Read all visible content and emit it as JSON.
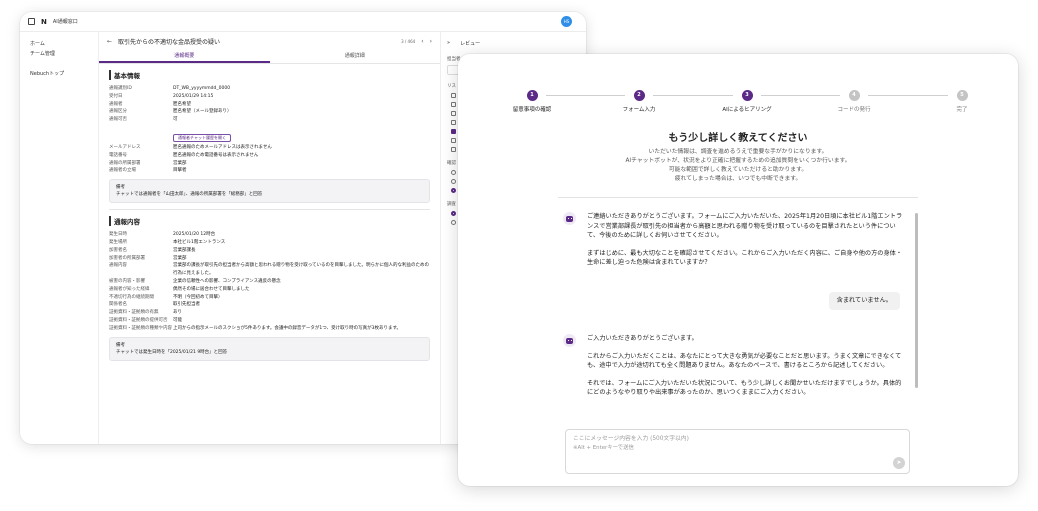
{
  "back_window": {
    "app_title": "AI通報窓口",
    "avatar_initials": "HS",
    "sidebar": [
      "ホーム",
      "チーム管理",
      "Nebuchトップ"
    ],
    "header": {
      "title": "取引先からの不適切な金品授受の疑い",
      "pager": "3 / 464"
    },
    "tabs": [
      "通報概要",
      "通報詳細"
    ],
    "basic_info": {
      "title": "基本情報",
      "rows": [
        {
          "k": "通報識別ID",
          "v": "DT_WB_yyyymmdd_0000"
        },
        {
          "k": "受付日",
          "v": "2025/01/29 14:15"
        },
        {
          "k": "通報者",
          "v": "匿名希望"
        },
        {
          "k": "通報区分",
          "v": "匿名希望（メール登録あり）"
        },
        {
          "k": "通報可否",
          "v": "可"
        }
      ],
      "chip": "通報者チャット履歴を開く",
      "rows2": [
        {
          "k": "メールアドレス",
          "v": "匿名通報のためメールアドレスは表示されません"
        },
        {
          "k": "電話番号",
          "v": "匿名通報のため電話番号は表示されません"
        },
        {
          "k": "通報の所属部署",
          "v": "営業部"
        },
        {
          "k": "通報者の立場",
          "v": "目撃者"
        }
      ],
      "note_label": "備考",
      "note_text": "チャットでは通報者を「山田太郎」、通報の所属部署を「総務部」と回答"
    },
    "report_content": {
      "title": "通報内容",
      "rows": [
        {
          "k": "発生日時",
          "v": "2025/01/20 12時台"
        },
        {
          "k": "発生場所",
          "v": "本社ビル1階エントランス"
        },
        {
          "k": "加害者名",
          "v": "営業部課長"
        },
        {
          "k": "加害者の所属部署",
          "v": "営業部"
        },
        {
          "k": "通報内容",
          "v": "営業部の課長が取引先の担当者から高額と思われる贈り物を受け取っているのを目撃しました。明らかに個人的な利益のための行為に見えました。"
        },
        {
          "k": "被害の内容・影響",
          "v": "企業の信頼性への影響、コンプライアンス違反の懸念"
        },
        {
          "k": "通報者が知った経緯",
          "v": "偶然その場に居合わせて目撃しました"
        },
        {
          "k": "不適切行為の継続期間",
          "v": "不明（今回初めて目撃）"
        },
        {
          "k": "関係者名",
          "v": "取引先担当者"
        },
        {
          "k": "証拠資料・証拠類の有無",
          "v": "あり"
        },
        {
          "k": "証拠資料・証拠類の提供可否",
          "v": "可能"
        },
        {
          "k": "証拠資料・証拠類の種類や内容",
          "v": "上司からの指示メールのスクショが5件あります。会議中の録音データが1つ、受け取り時の写真が3枚あります。"
        }
      ],
      "note_label": "備考",
      "note_text": "チャットでは発生日時を「2025/01/21 9時台」と回答"
    },
    "review": {
      "title": "レビュー",
      "label1": "担当者",
      "label2": "リス",
      "label3": "確認",
      "label4": "調査"
    }
  },
  "front_window": {
    "steps": [
      {
        "num": "1",
        "label": "留意事項の確認",
        "state": "done"
      },
      {
        "num": "2",
        "label": "フォーム入力",
        "state": "done"
      },
      {
        "num": "3",
        "label": "AIによるヒアリング",
        "state": "done"
      },
      {
        "num": "4",
        "label": "コードの発行",
        "state": "todo"
      },
      {
        "num": "5",
        "label": "完了",
        "state": "todo"
      }
    ],
    "heading": "もう少し詳しく教えてください",
    "intro": [
      "いただいた情報は、調査を進めるうえで重要な手がかりになります。",
      "AIチャットボットが、状況をより正確に把握するための追加質問をいくつか行います。",
      "可能な範囲で詳しく教えていただけると助かります。",
      "疲れてしまった場合は、いつでも中断できます。"
    ],
    "messages": {
      "bot1_p1": "ご連絡いただきありがとうございます。フォームにご入力いただいた、2025年1月20日頃に本社ビル1階エントランスで営業部課長が取引先の担当者から高額と思われる贈り物を受け取っているのを目撃されたという件について、今後のために詳しくお伺いさせてください。",
      "bot1_p2": "まずはじめに、最も大切なことを確認させてください。これからご入力いただく内容に、ご自身や他の方の身体・生命に差し迫った危険は含まれていますか？",
      "user1": "含まれていません。",
      "bot2_p1": "ご入力いただきありがとうございます。",
      "bot2_p2": "これからご入力いただくことは、あなたにとって大きな勇気が必要なことだと思います。うまく文章にできなくても、途中で入力が途切れても全く問題ありません。あなたのペースで、書けるところから記述してください。",
      "bot2_p3": "それでは、フォームにご入力いただいた状況について、もう少し詳しくお聞かせいただけますでしょうか。具体的にどのようなやり取りや出来事があったのか、思いつくままにご入力ください。"
    },
    "composer": {
      "placeholder": "ここにメッセージ内容を入力 (500文字以内)",
      "hint": "※Alt + Enterキーで送信"
    }
  }
}
